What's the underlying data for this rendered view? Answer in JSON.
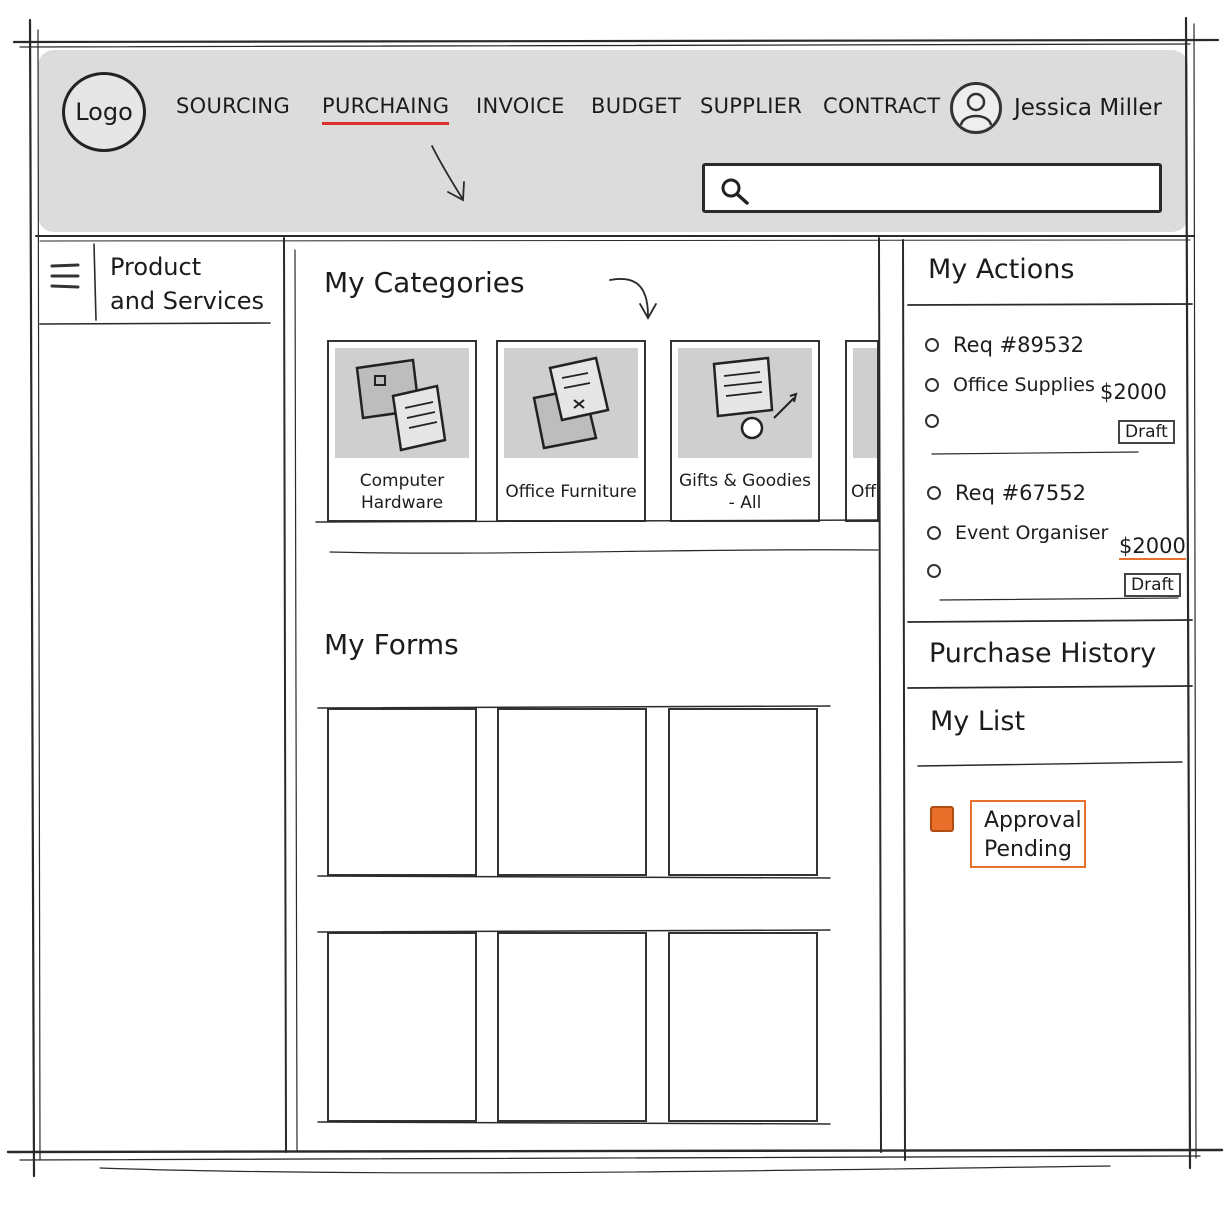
{
  "header": {
    "logo": "Logo",
    "nav": [
      {
        "label": "SOURCING",
        "active": false
      },
      {
        "label": "PURCHAING",
        "active": true
      },
      {
        "label": "INVOICE",
        "active": false
      },
      {
        "label": "BUDGET",
        "active": false
      },
      {
        "label": "SUPPLIER",
        "active": false
      },
      {
        "label": "CONTRACT",
        "active": false
      }
    ],
    "user": {
      "name": "Jessica Miller",
      "icon": "user-avatar-icon"
    },
    "search": {
      "icon": "search-icon",
      "value": ""
    }
  },
  "left_panel": {
    "menu_icon": "hamburger-menu-icon",
    "title": "Product\nand Services"
  },
  "main": {
    "categories_title": "My Categories",
    "categories": [
      {
        "label": "Computer\nHardware",
        "icon": "documents-icon"
      },
      {
        "label": "Office Furniture",
        "icon": "papers-icon"
      },
      {
        "label": "Gifts & Goodies\n- All",
        "icon": "gift-card-icon"
      },
      {
        "label": "Off",
        "icon": "partial-card-icon"
      }
    ],
    "forms_title": "My Forms"
  },
  "right_panel": {
    "actions_title": "My Actions",
    "actions": [
      {
        "req": "Req #89532",
        "item": "Office Supplies",
        "amount": "$2000",
        "status": "Draft"
      },
      {
        "req": "Req #67552",
        "item": "Event Organiser",
        "amount": "$2000",
        "status": "Draft"
      }
    ],
    "purchase_history": "Purchase History",
    "my_list_title": "My List",
    "list_items": [
      {
        "label": "Approval\nPending",
        "checked": true
      }
    ]
  },
  "colors": {
    "active_underline": "#d9322b",
    "approval_accent": "#e8702a",
    "header_bg": "#dcdcdc"
  }
}
